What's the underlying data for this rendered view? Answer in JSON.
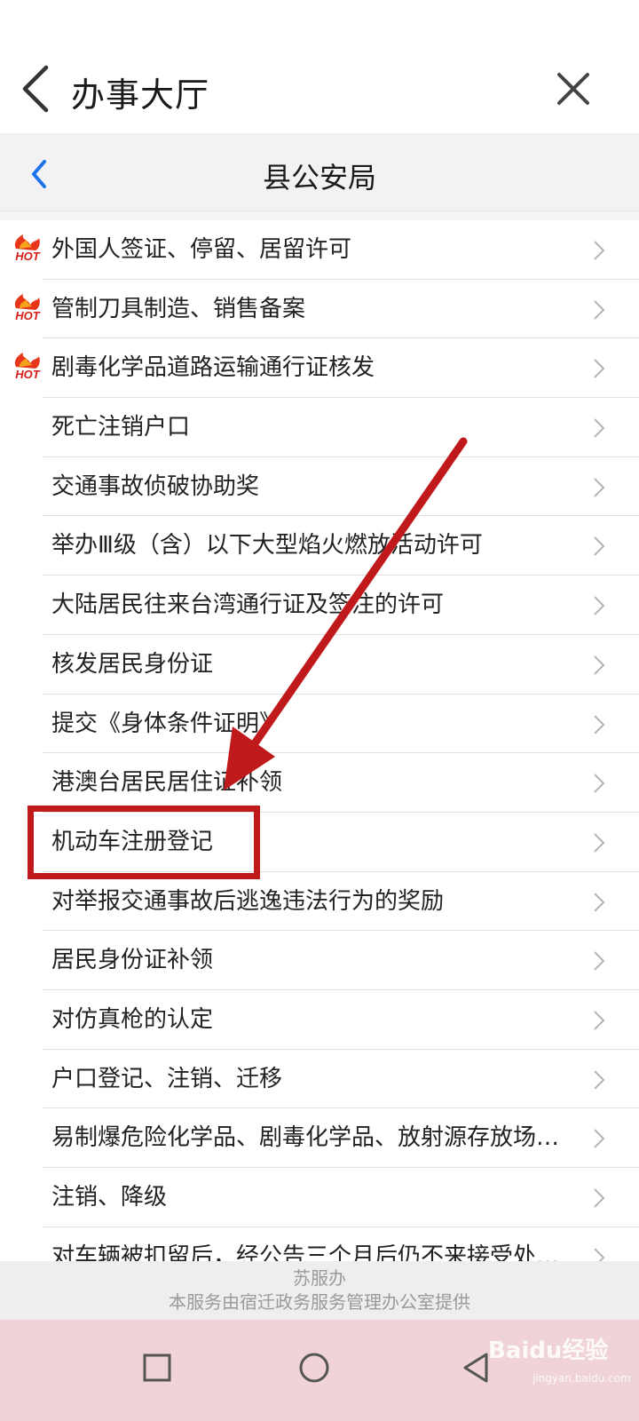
{
  "header": {
    "title": "办事大厅"
  },
  "subheader": {
    "title": "县公安局"
  },
  "hot_badge_text": "HOT",
  "items": [
    {
      "label": "外国人签证、停留、居留许可",
      "hot": true
    },
    {
      "label": "管制刀具制造、销售备案",
      "hot": true
    },
    {
      "label": "剧毒化学品道路运输通行证核发",
      "hot": true
    },
    {
      "label": "死亡注销户口",
      "hot": false
    },
    {
      "label": "交通事故侦破协助奖",
      "hot": false
    },
    {
      "label": "举办Ⅲ级（含）以下大型焰火燃放活动许可",
      "hot": false
    },
    {
      "label": "大陆居民往来台湾通行证及签注的许可",
      "hot": false
    },
    {
      "label": "核发居民身份证",
      "hot": false
    },
    {
      "label": "提交《身体条件证明》",
      "hot": false
    },
    {
      "label": "港澳台居民居住证补领",
      "hot": false
    },
    {
      "label": "机动车注册登记",
      "hot": false
    },
    {
      "label": "对举报交通事故后逃逸违法行为的奖励",
      "hot": false
    },
    {
      "label": "居民身份证补领",
      "hot": false
    },
    {
      "label": "对仿真枪的认定",
      "hot": false
    },
    {
      "label": "户口登记、注销、迁移",
      "hot": false
    },
    {
      "label": "易制爆危险化学品、剧毒化学品、放射源存放场…",
      "hot": false
    },
    {
      "label": "注销、降级",
      "hot": false
    },
    {
      "label": "对车辆被扣留后，经公告三个月后仍不来接受处…",
      "hot": false
    }
  ],
  "footer": {
    "brand": "苏服办",
    "note": "本服务由宿迁政务服务管理办公室提供"
  },
  "watermark": {
    "logo": "Baidu经验",
    "sub": "jingyan.baidu.com"
  },
  "colors": {
    "accent_blue": "#1a73e8",
    "annotation_red": "#c0191b",
    "nav_bar": "#efd3d8"
  }
}
